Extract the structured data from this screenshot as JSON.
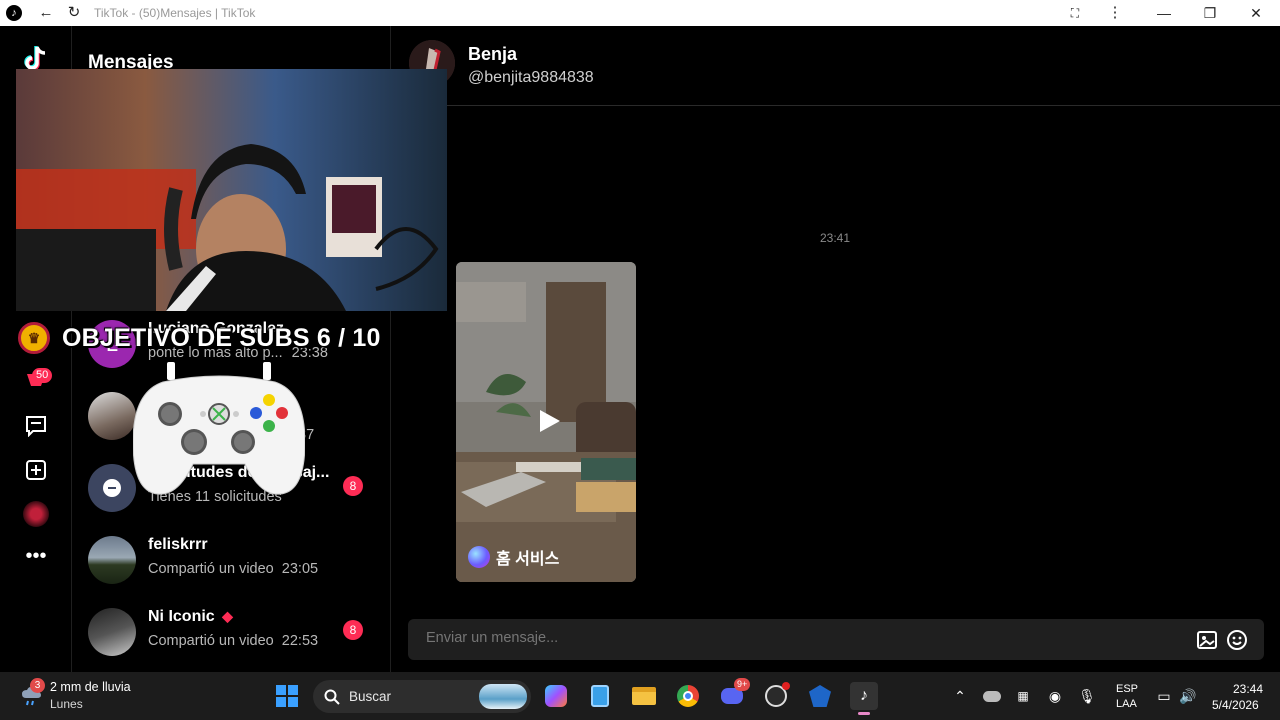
{
  "browser": {
    "tab_title": "TikTok - (50)Mensajes | TikTok"
  },
  "sidebar": {
    "notification_count": "50"
  },
  "conversations": {
    "heading": "Mensajes",
    "items": [
      {
        "avatar_letter": "L",
        "name": "Luciano Gonzalez",
        "preview": "ponte lo más alto p...",
        "time": "23:38",
        "count": ""
      },
      {
        "avatar_letter": "",
        "name": "",
        "preview": "",
        "time": "37",
        "count": ""
      },
      {
        "avatar_letter": "",
        "name": "Solicitudes de mensaj...",
        "preview": "Tienes 11 solicitudes",
        "time": "",
        "count": "8"
      },
      {
        "avatar_letter": "",
        "name": "feliskrrr",
        "preview": "Compartió un video",
        "time": "23:05",
        "count": ""
      },
      {
        "avatar_letter": "",
        "name": "Ni Iconic",
        "preview": "Compartió un video",
        "time": "22:53",
        "count": "8"
      }
    ]
  },
  "chat": {
    "name": "Benja",
    "handle": "@benjita9884838",
    "timestamp": "23:41",
    "video_brand": "홈 서비스",
    "composer_placeholder": "Enviar un mensaje..."
  },
  "overlay": {
    "subs_goal": "OBJETIVO DE SUBS 6 / 10"
  },
  "taskbar": {
    "weather_badge": "3",
    "weather_temp": "2 mm de lluvia",
    "weather_day": "Lunes",
    "search_label": "Buscar",
    "discord_badge": "9+",
    "lang_line1": "ESP",
    "lang_line2": "LAA",
    "time": "23:44",
    "date": "5/4/2026"
  },
  "colors": {
    "accent": "#fe2c55",
    "background": "#000000",
    "taskbar": "#1c1c1c"
  }
}
